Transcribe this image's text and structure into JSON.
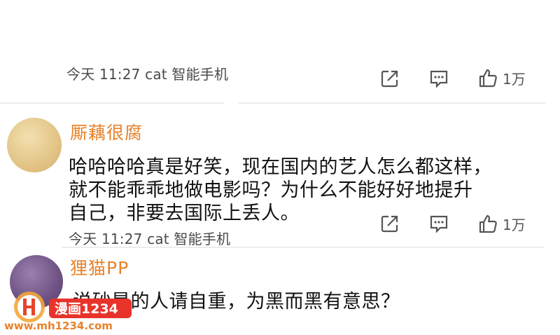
{
  "accent": "#e8822a",
  "comments": [
    {
      "meta": "今天 11:27 cat 智能手机",
      "actions": {
        "share_icon": "share-icon",
        "reply_icon": "comment-icon",
        "like_icon": "thumbs-up-icon",
        "like_count": "1万"
      }
    },
    {
      "username": "厮藕很腐",
      "avatar_color": "#e9cf93",
      "lines": [
        "哈哈哈哈真是好笑，现在国内的艺人怎么都这样，",
        "就不能乖乖地做电影吗？为什么不能好好地提升",
        "自己，非要去国际上丢人。"
      ],
      "meta": "今天 11:27 cat 智能手机",
      "actions": {
        "share_icon": "share-icon",
        "reply_icon": "comment-icon",
        "like_icon": "thumbs-up-icon",
        "like_count": "1万"
      }
    },
    {
      "username": "狸猫PP",
      "avatar_color": "#7d5f8f",
      "lines": [
        "说砂是的人请自重，为黑而黑有意思？"
      ]
    }
  ],
  "watermark": {
    "brand": "漫画1234",
    "url": "www.mh1234.com"
  }
}
